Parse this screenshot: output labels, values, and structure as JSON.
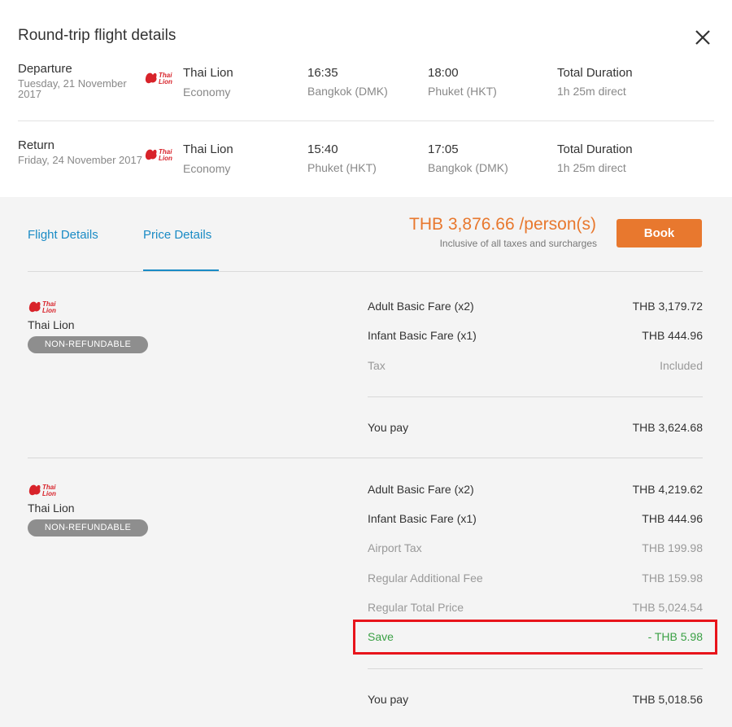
{
  "dialog": {
    "title": "Round-trip flight details"
  },
  "segments": [
    {
      "label": "Departure",
      "date": "Tuesday, 21 November 2017",
      "airline": "Thai Lion",
      "cabin": "Economy",
      "dep_time": "16:35",
      "dep_place": "Bangkok (DMK)",
      "arr_time": "18:00",
      "arr_place": "Phuket (HKT)",
      "duration_label": "Total Duration",
      "duration_value": "1h 25m direct"
    },
    {
      "label": "Return",
      "date": "Friday, 24 November 2017",
      "airline": "Thai Lion",
      "cabin": "Economy",
      "dep_time": "15:40",
      "dep_place": "Phuket (HKT)",
      "arr_time": "17:05",
      "arr_place": "Bangkok (DMK)",
      "duration_label": "Total Duration",
      "duration_value": "1h 25m direct"
    }
  ],
  "tabs": [
    {
      "label": "Flight Details",
      "active": false
    },
    {
      "label": "Price Details",
      "active": true
    }
  ],
  "summary": {
    "price": "THB 3,876.66 /person(s)",
    "note": "Inclusive of all taxes and surcharges",
    "book_label": "Book"
  },
  "breakdowns": [
    {
      "airline": "Thai Lion",
      "badge": "NON-REFUNDABLE",
      "rows": [
        {
          "label": "Adult Basic Fare (x2)",
          "value": "THB 3,179.72",
          "style": "dark"
        },
        {
          "label": "Infant Basic Fare (x1)",
          "value": "THB 444.96",
          "style": "dark"
        },
        {
          "label": "Tax",
          "value": "Included",
          "style": "muted"
        }
      ],
      "total_label": "You pay",
      "total_value": "THB 3,624.68"
    },
    {
      "airline": "Thai Lion",
      "badge": "NON-REFUNDABLE",
      "rows": [
        {
          "label": "Adult Basic Fare (x2)",
          "value": "THB 4,219.62",
          "style": "dark"
        },
        {
          "label": "Infant Basic Fare (x1)",
          "value": "THB 444.96",
          "style": "dark"
        },
        {
          "label": "Airport Tax",
          "value": "THB 199.98",
          "style": "muted"
        },
        {
          "label": "Regular Additional Fee",
          "value": "THB 159.98",
          "style": "muted"
        },
        {
          "label": "Regular Total Price",
          "value": "THB 5,024.54",
          "style": "muted"
        },
        {
          "label": "Save",
          "value": "- THB 5.98",
          "style": "green"
        }
      ],
      "total_label": "You pay",
      "total_value": "THB 5,018.56"
    }
  ],
  "colors": {
    "accent_blue": "#1a8bc5",
    "accent_orange": "#e8782e",
    "save_green": "#3aa045",
    "highlight_red": "#e8141b",
    "badge_gray": "#8e8e8e"
  },
  "icons": {
    "close": "close-icon",
    "airline_logo": "thai-lion-logo-icon"
  }
}
